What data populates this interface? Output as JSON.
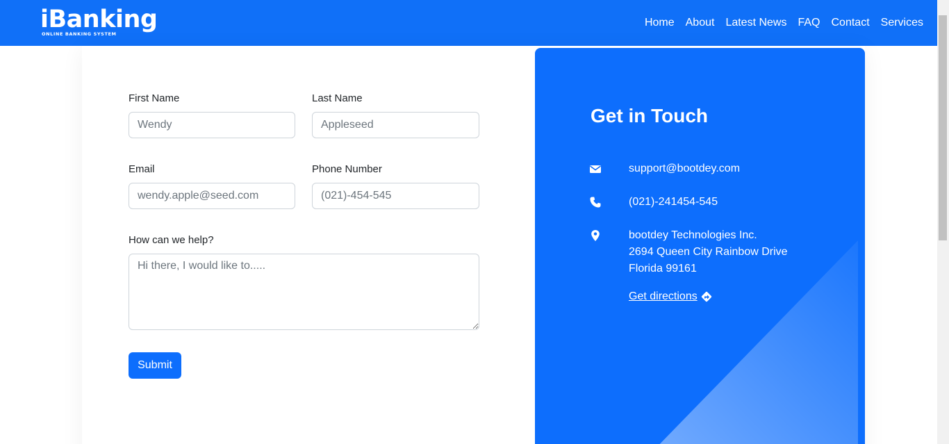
{
  "brand": {
    "name": "iBanking",
    "tagline": "ONLINE BANKING SYSTEM"
  },
  "nav": {
    "items": [
      "Home",
      "About",
      "Latest News",
      "FAQ",
      "Contact",
      "Services"
    ]
  },
  "form": {
    "first_name": {
      "label": "First Name",
      "placeholder": "Wendy"
    },
    "last_name": {
      "label": "Last Name",
      "placeholder": "Appleseed"
    },
    "email": {
      "label": "Email",
      "placeholder": "wendy.apple@seed.com"
    },
    "phone": {
      "label": "Phone Number",
      "placeholder": "(021)-454-545"
    },
    "message": {
      "label": "How can we help?",
      "placeholder": "Hi there, I would like to....."
    },
    "submit_label": "Submit"
  },
  "contact": {
    "title": "Get in Touch",
    "email": "support@bootdey.com",
    "phone": "(021)-241454-545",
    "address": [
      "bootdey Technologies Inc.",
      "2694 Queen City Rainbow Drive",
      "Florida 99161"
    ],
    "directions_label": "Get directions",
    "icons": [
      "envelope-icon",
      "phone-icon",
      "map-pin-icon",
      "directions-icon"
    ]
  },
  "colors": {
    "navbar": "#1070f8",
    "primary": "#0d6efd"
  }
}
